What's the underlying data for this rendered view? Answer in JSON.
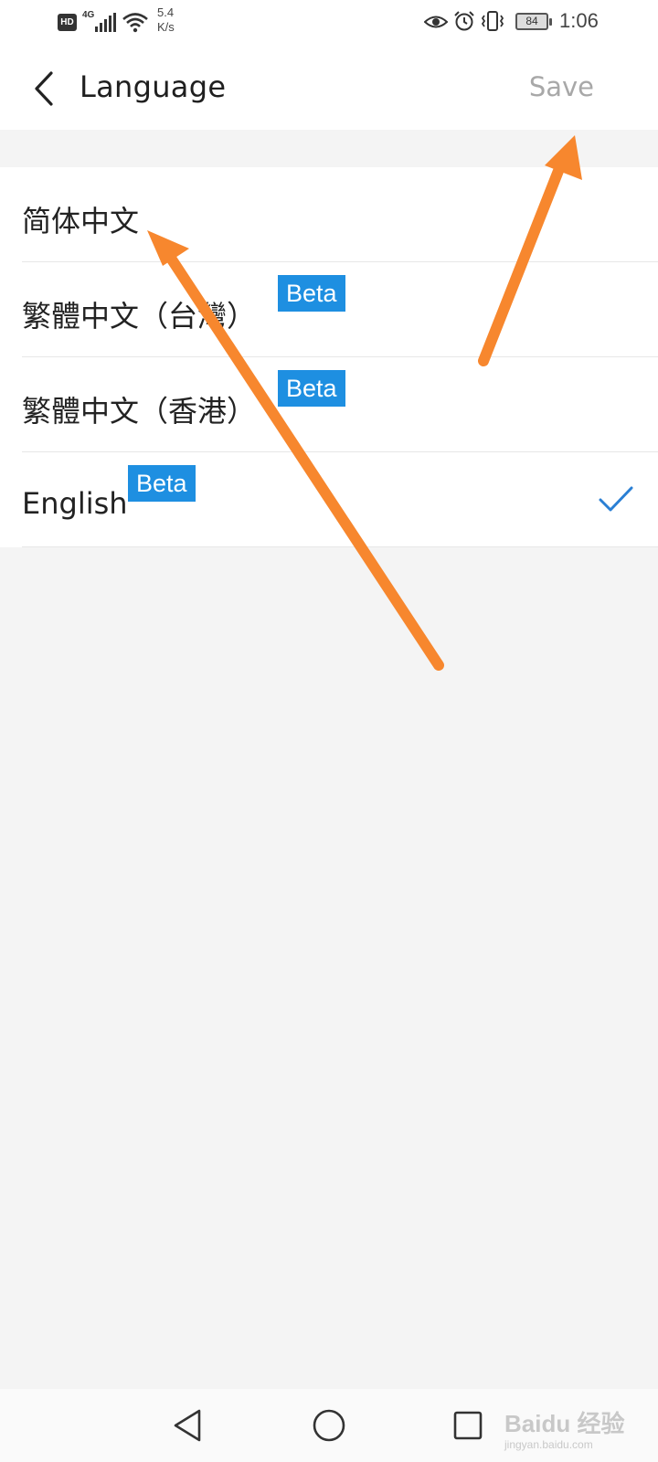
{
  "status_bar": {
    "hd": "HD",
    "network": "4G",
    "speed_value": "5.4",
    "speed_unit": "K/s",
    "battery": "84",
    "time": "1:06",
    "icons": [
      "hd-icon",
      "signal-icon",
      "wifi-icon",
      "eye-icon",
      "alarm-icon",
      "vibrate-icon",
      "battery-icon"
    ]
  },
  "header": {
    "title": "Language",
    "save_label": "Save",
    "back_icon": "chevron-left-icon"
  },
  "languages": [
    {
      "label": "简体中文",
      "beta": false,
      "selected": false
    },
    {
      "label": "繁體中文（台灣）",
      "beta": true,
      "badge": "Beta",
      "selected": false
    },
    {
      "label": "繁體中文（香港）",
      "beta": true,
      "badge": "Beta",
      "selected": false
    },
    {
      "label": "English",
      "beta": true,
      "badge": "Beta",
      "selected": true
    }
  ],
  "nav_bar": {
    "icons": [
      "nav-back-icon",
      "nav-home-icon",
      "nav-recent-icon"
    ]
  },
  "watermark": {
    "text": "Baidu 经验",
    "sub": "jingyan.baidu.com"
  },
  "colors": {
    "accent": "#1e8fe1",
    "check": "#2a7fd4",
    "arrow": "#f7872e",
    "save_disabled": "#a8a8a8",
    "background": "#f4f4f4"
  }
}
